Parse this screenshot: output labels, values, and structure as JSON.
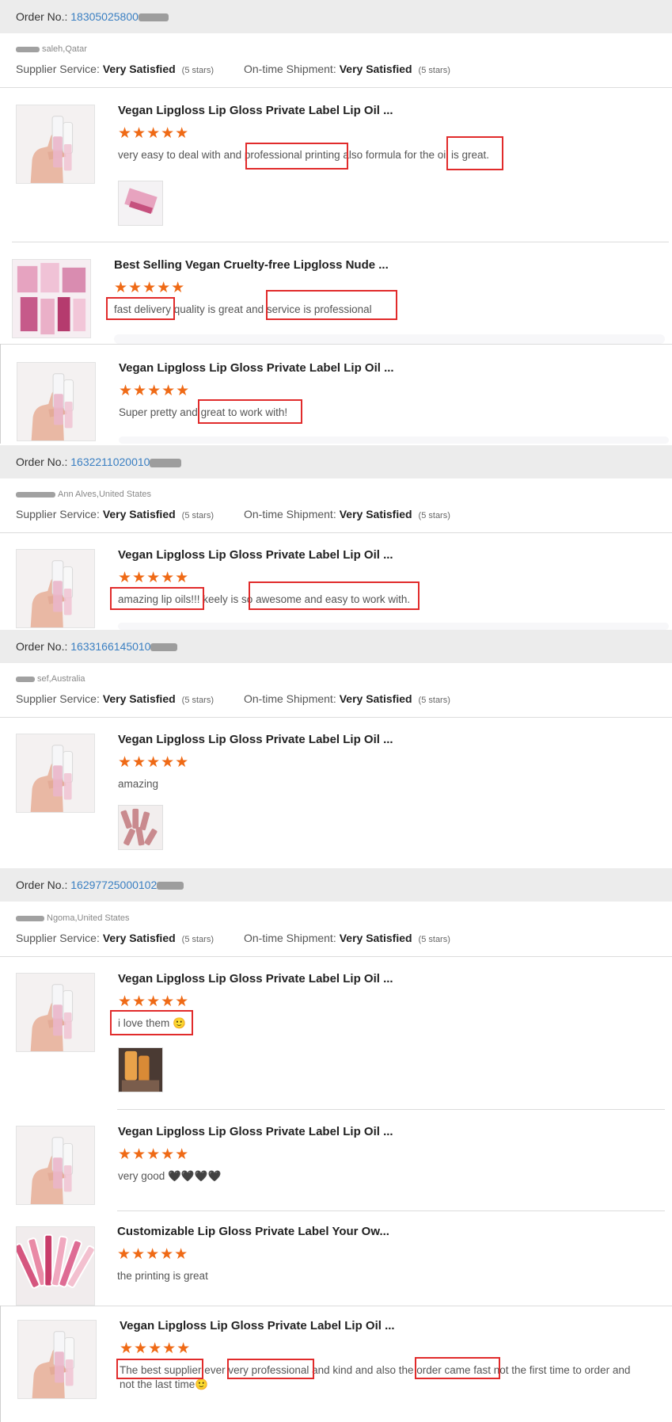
{
  "labels": {
    "order_no": "Order No.: ",
    "supplier_service": "Supplier Service:",
    "on_time_shipment": "On-time Shipment:",
    "rating_value": "Very Satisfied",
    "stars_text": "(5 stars)",
    "stars": "★★★★★"
  },
  "colors": {
    "accent_stars": "#ef6a16",
    "order_number": "#3a7fc2",
    "highlight_box": "#e12b2b",
    "order_bar_bg": "#ececec"
  },
  "orders": [
    {
      "number": "18305025800",
      "buyer": "saleh,Qatar"
    },
    {
      "number": "1632211020010",
      "buyer": "Ann Alves,United States"
    },
    {
      "number": "1633166145010",
      "buyer": "sef,Australia"
    },
    {
      "number": "16297725000102",
      "buyer": "Ngoma,United States"
    }
  ],
  "reviews": [
    {
      "title": "Vegan Lipgloss Lip Gloss Private Label Lip Oil ...",
      "comment": "very easy to deal with and professional printing also formula for the oil is great."
    },
    {
      "title": "Best Selling Vegan Cruelty-free Lipgloss Nude ...",
      "comment": "fast delivery quality is great and service is professional"
    },
    {
      "title": "Vegan Lipgloss Lip Gloss Private Label Lip Oil ...",
      "comment": "Super pretty and great to work with!"
    },
    {
      "title": "Vegan Lipgloss Lip Gloss Private Label Lip Oil ...",
      "comment": "amazing lip oils!!! keely is so awesome and easy to work with."
    },
    {
      "title": "Vegan Lipgloss Lip Gloss Private Label Lip Oil ...",
      "comment": "amazing"
    },
    {
      "title": "Vegan Lipgloss Lip Gloss Private Label Lip Oil ...",
      "comment": "i love them 🙂"
    },
    {
      "title": "Vegan Lipgloss Lip Gloss Private Label Lip Oil ...",
      "comment": "very good 🖤🖤🖤🖤"
    },
    {
      "title": "Customizable Lip Gloss Private Label Your Ow...",
      "comment": "the printing is great"
    },
    {
      "title": "Vegan Lipgloss Lip Gloss Private Label Lip Oil ...",
      "comment": "The best supplier ever very professional and kind and also the order came fast not the first time to order and not the last time🙂"
    }
  ]
}
